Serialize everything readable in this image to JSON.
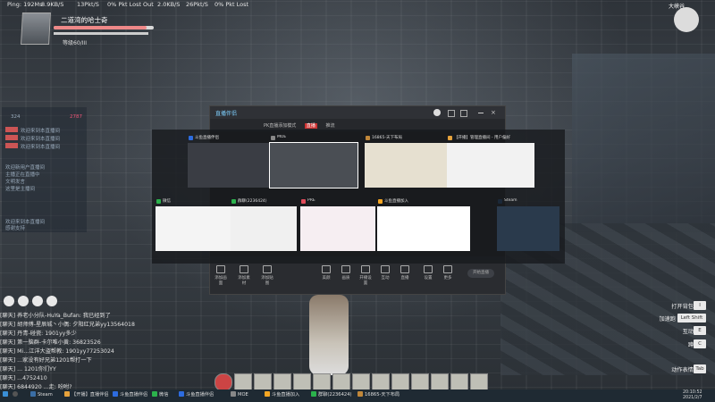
{
  "netbar": {
    "ping": "Ping: 192Ms",
    "in_kb": "8.9KB/S",
    "in_pkt": "13Pkt/S",
    "in_loss": "0% Pkt Lost",
    "out_label": "Out",
    "out_kb": "2.0KB/S",
    "out_pkt": "26Pkt/S",
    "out_loss": "0% Pkt Lost"
  },
  "player": {
    "name": "二道湾的哈士奇",
    "level": "等级60/III",
    "hp_fraction": 0.93
  },
  "map": {
    "name": "大峡谷"
  },
  "left_panel": {
    "stat_a": "324",
    "stat_b": "2787",
    "lines": [
      "欢迎来到本直播间",
      "欢迎来到本直播间",
      "欢迎来到本直播间"
    ],
    "notice": [
      "欢迎新用户直播间",
      "主播正在直播中",
      "文明发言",
      "这里是主播间"
    ],
    "tip": [
      "欢迎来到本直播间",
      "感谢支持"
    ]
  },
  "obs": {
    "app_name": "直播伴侣",
    "tabs": [
      "PK直播添加模式",
      "直播",
      "推流"
    ],
    "bottom_left": [
      "添加画面",
      "添加素材",
      "添加贴图"
    ],
    "bottom_right": [
      "美颜",
      "画质",
      "开播设置",
      "互动",
      "直播",
      "设置",
      "更多"
    ],
    "live_button": "开始直播"
  },
  "taskview": {
    "row1": [
      {
        "label": "斗鱼直播伴侣",
        "color": "#2d6cdf",
        "bg": "#3a3d44"
      },
      {
        "label": "MOE",
        "color": "#888888",
        "bg": "#4a4e54"
      },
      {
        "label": "16865-天下布局",
        "color": "#c0873a",
        "bg": "#e6e0d0"
      },
      {
        "label": "【开播】管理直播间 - 用户偏好",
        "color": "#e6a23c",
        "bg": "#f2f2f2"
      }
    ],
    "row2": [
      {
        "label": "微信",
        "color": "#2bb24c",
        "bg": "#f4f4f4"
      },
      {
        "label": "群聊(2236424)",
        "color": "#2bb24c",
        "bg": "#f0f0f0"
      },
      {
        "label": "PRE",
        "color": "#e04a5a",
        "bg": "#f6eef2"
      },
      {
        "label": "斗鱼直播加入",
        "color": "#f5a623",
        "bg": "#ffffff"
      },
      {
        "label": "Steam",
        "color": "#1b2838",
        "bg": "#2a3a4c"
      }
    ]
  },
  "chat": [
    "[聊天] 养老小分队-HuYa_Bufan: 我已经到了",
    "[聊天] 胡师傅-星辰城丶小偶: 夕阳红兄弟yy13564018",
    "[聊天] 丹青-碰瓷: 1901yy多少",
    "[聊天] 第一脑群-卡尔唯小黄: 36823526",
    "[聊天] Mi...江洋大盗帮教: 1901yy77253024",
    "[聊天] ...家没有好兄弟1201帮打一下",
    "[聊天] ... 1201你们YY",
    "[聊天] ...4752410",
    "[聊天] 6844920 ...走: 吩咐?"
  ],
  "hints": [
    {
      "label": "打开背包",
      "key": "I"
    },
    {
      "label": "加速跑",
      "key": "Left Shift"
    },
    {
      "label": "互动",
      "key": "E"
    },
    {
      "label": "蹲",
      "key": "C"
    },
    {
      "label": "动作表情",
      "key": "Tab"
    }
  ],
  "taskbar": {
    "items": [
      {
        "label": "Steam",
        "color": "#3a6ea5"
      },
      {
        "label": "【开播】直播伴侣",
        "color": "#e6a23c"
      },
      {
        "label": "斗鱼直播伴侣",
        "color": "#2d6cdf"
      },
      {
        "label": "微信",
        "color": "#2bb24c"
      },
      {
        "label": "斗鱼直播伴侣",
        "color": "#2d6cdf"
      },
      {
        "label": "MOE",
        "color": "#888888"
      },
      {
        "label": "斗鱼直播加入",
        "color": "#f5a623"
      },
      {
        "label": "群聊(2236424)",
        "color": "#2bb24c"
      },
      {
        "label": "16865-天下布局",
        "color": "#c0873a"
      }
    ],
    "time": "20:10:52",
    "date": "2021/2/7"
  }
}
